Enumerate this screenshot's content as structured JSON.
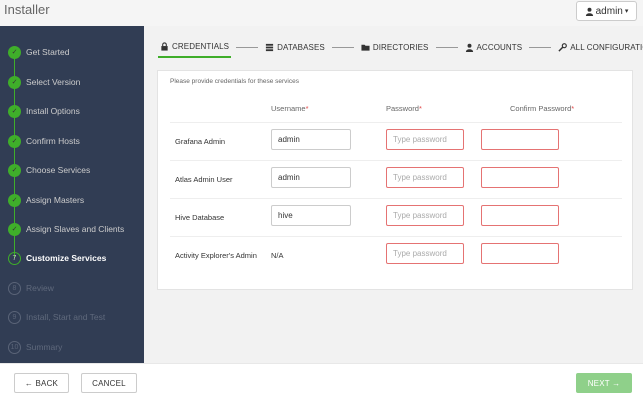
{
  "header": {
    "app_title": "Installer",
    "user_label": "admin"
  },
  "sidebar": {
    "steps": [
      {
        "label": "Get Started",
        "state": "done",
        "marker": "✓"
      },
      {
        "label": "Select Version",
        "state": "done",
        "marker": "✓"
      },
      {
        "label": "Install Options",
        "state": "done",
        "marker": "✓"
      },
      {
        "label": "Confirm Hosts",
        "state": "done",
        "marker": "✓"
      },
      {
        "label": "Choose Services",
        "state": "done",
        "marker": "✓"
      },
      {
        "label": "Assign Masters",
        "state": "done",
        "marker": "✓"
      },
      {
        "label": "Assign Slaves and Clients",
        "state": "done",
        "marker": "✓"
      },
      {
        "label": "Customize Services",
        "state": "current",
        "marker": "7"
      },
      {
        "label": "Review",
        "state": "todo",
        "marker": "8"
      },
      {
        "label": "Install, Start and Test",
        "state": "todo",
        "marker": "9"
      },
      {
        "label": "Summary",
        "state": "todo",
        "marker": "10"
      }
    ]
  },
  "tabs": [
    {
      "label": "CREDENTIALS",
      "icon": "lock-icon",
      "active": true
    },
    {
      "label": "DATABASES",
      "icon": "database-icon",
      "active": false
    },
    {
      "label": "DIRECTORIES",
      "icon": "folder-icon",
      "active": false
    },
    {
      "label": "ACCOUNTS",
      "icon": "user-icon",
      "active": false
    },
    {
      "label": "ALL CONFIGURATIONS",
      "icon": "wrench-icon",
      "active": false
    }
  ],
  "credentials": {
    "intro": "Please provide credentials for these services",
    "columns": {
      "username": "Username",
      "password": "Password",
      "confirm": "Confirm Password",
      "required_mark": "*"
    },
    "password_placeholder": "Type password",
    "rows": [
      {
        "label": "Grafana Admin",
        "username": "admin"
      },
      {
        "label": "Atlas Admin User",
        "username": "admin"
      },
      {
        "label": "Hive Database",
        "username": "hive"
      },
      {
        "label": "Activity Explorer's Admin",
        "username_text": "N/A"
      }
    ]
  },
  "footer": {
    "back_label": "← BACK",
    "cancel_label": "CANCEL",
    "next_label": "NEXT →"
  },
  "colors": {
    "accent": "#3fae2a",
    "sidebar_bg": "#313d54",
    "error_border": "#e57373",
    "next_disabled": "#8fd08a"
  }
}
